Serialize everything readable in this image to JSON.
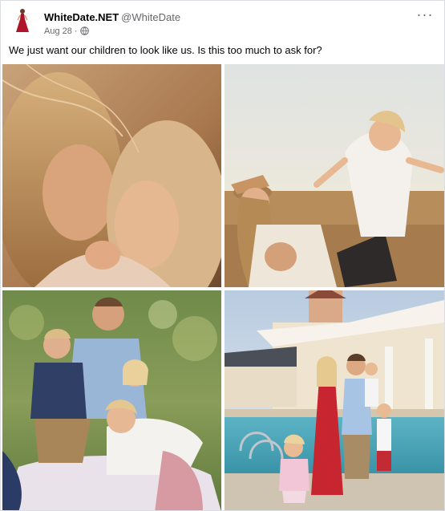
{
  "post": {
    "author_name": "WhiteDate.NET",
    "author_handle": "@WhiteDate",
    "date": "Aug 28",
    "dot": "·",
    "audience_icon": "globe-icon",
    "more_icon": "more-horizontal-icon",
    "more_label": "···",
    "caption": "We just want our children to look like us. Is this too much to ask for?"
  },
  "photos": [
    {
      "description": "mother-and-daughter-closeup"
    },
    {
      "description": "mother-lifting-child-in-field"
    },
    {
      "description": "family-sitting-in-meadow"
    },
    {
      "description": "family-by-pool"
    }
  ]
}
